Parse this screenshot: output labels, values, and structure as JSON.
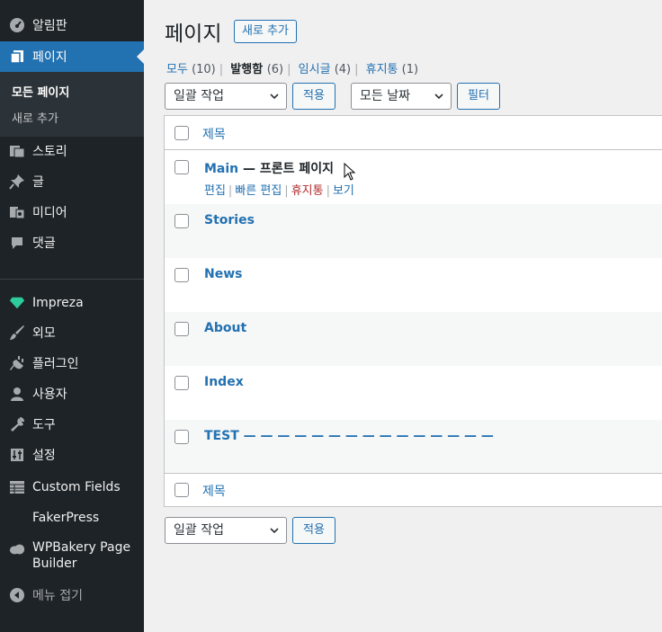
{
  "sidebar": {
    "items": [
      {
        "label": "알림판",
        "icon": "dashboard-icon"
      },
      {
        "label": "페이지",
        "icon": "pages-icon"
      },
      {
        "label": "스토리",
        "icon": "stories-icon"
      },
      {
        "label": "글",
        "icon": "pin-icon"
      },
      {
        "label": "미디어",
        "icon": "media-icon"
      },
      {
        "label": "댓글",
        "icon": "comment-icon"
      },
      {
        "label": "Impreza",
        "icon": "diamond-icon"
      },
      {
        "label": "외모",
        "icon": "brush-icon"
      },
      {
        "label": "플러그인",
        "icon": "plugin-icon"
      },
      {
        "label": "사용자",
        "icon": "user-icon"
      },
      {
        "label": "도구",
        "icon": "wrench-icon"
      },
      {
        "label": "설정",
        "icon": "settings-icon"
      },
      {
        "label": "Custom Fields",
        "icon": "table-icon"
      },
      {
        "label": "FakerPress",
        "icon": ""
      },
      {
        "label": "WPBakery Page",
        "label2": "Builder",
        "icon": "cloud-icon"
      },
      {
        "label": "메뉴 접기",
        "icon": "collapse-icon"
      }
    ],
    "submenu": {
      "all_pages": "모든 페이지",
      "add_new": "새로 추가"
    }
  },
  "header": {
    "title": "페이지",
    "add_new": "새로 추가"
  },
  "views": {
    "all": "모두",
    "all_count": "(10)",
    "published": "발행함",
    "published_count": "(6)",
    "draft": "임시글",
    "draft_count": "(4)",
    "trash": "휴지통",
    "trash_count": "(1)"
  },
  "filters": {
    "bulk_action": "일괄 작업",
    "apply": "적용",
    "all_dates": "모든 날짜",
    "filter": "필터"
  },
  "table": {
    "column_title": "제목",
    "rows": [
      {
        "title": "Main",
        "state": " — 프론트 페이지"
      },
      {
        "title": "Stories",
        "state": ""
      },
      {
        "title": "News",
        "state": ""
      },
      {
        "title": "About",
        "state": ""
      },
      {
        "title": "Index",
        "state": ""
      },
      {
        "title": "TEST — — — — — — — — — — — — — — —",
        "state": ""
      }
    ],
    "row_actions": {
      "edit": "편집",
      "quick_edit": "빠른 편집",
      "trash": "휴지통",
      "view": "보기"
    }
  },
  "colors": {
    "sidebar_bg": "#1d2327",
    "accent": "#2271b1",
    "trash_red": "#b32d2e"
  }
}
